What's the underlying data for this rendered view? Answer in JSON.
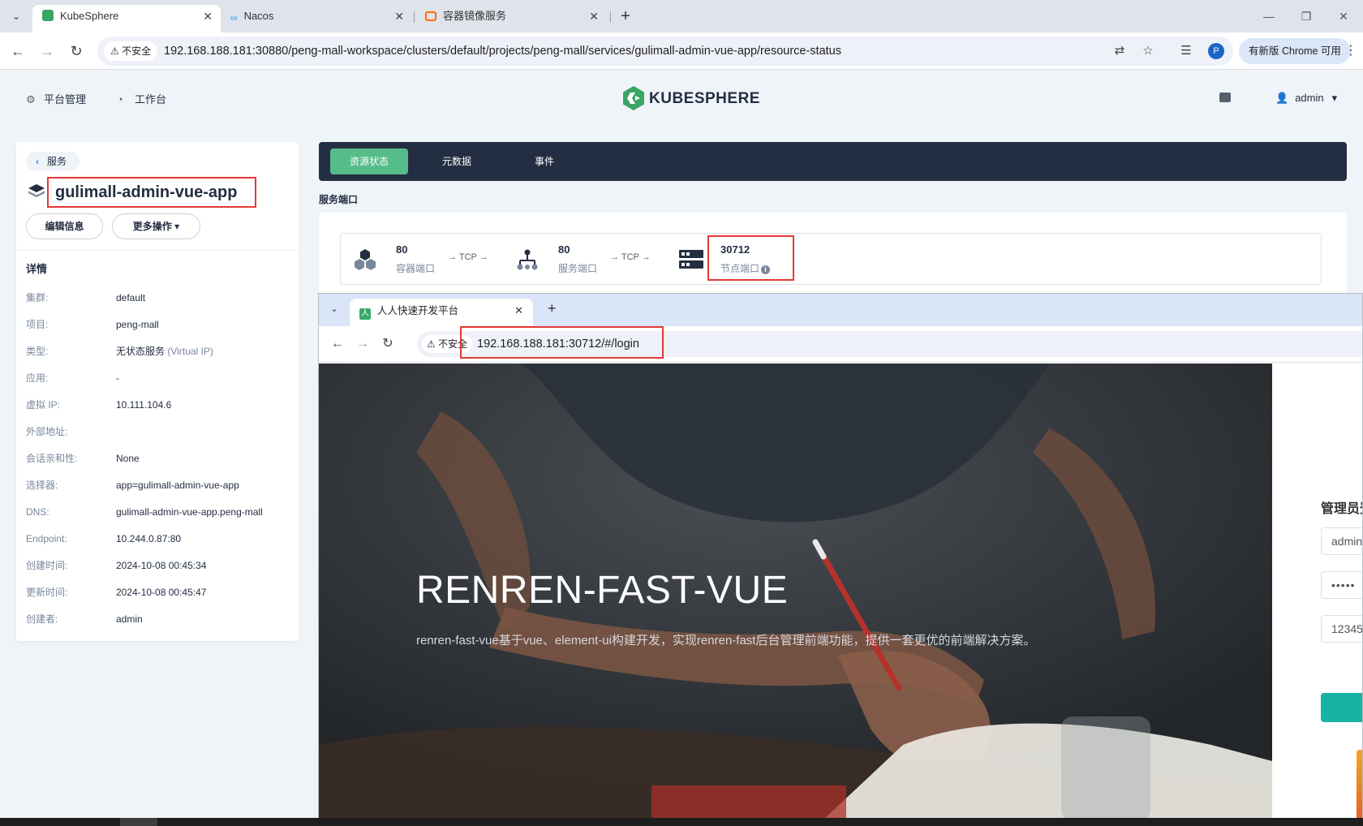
{
  "browser": {
    "tabs": [
      {
        "title": "KubeSphere",
        "active": true
      },
      {
        "title": "Nacos",
        "active": false
      },
      {
        "title": "容器镜像服务",
        "active": false
      }
    ],
    "security_label": "不安全",
    "url": "192.168.188.181:30880/peng-mall-workspace/clusters/default/projects/peng-mall/services/gulimall-admin-vue-app/resource-status",
    "profile_initial": "P",
    "update_label": "有新版 Chrome 可用"
  },
  "header": {
    "platform_label": "平台管理",
    "workbench_label": "工作台",
    "logo_text": "KUBESPHERE",
    "user_name": "admin"
  },
  "service": {
    "back_label": "服务",
    "name": "gulimall-admin-vue-app",
    "edit_label": "编辑信息",
    "more_label": "更多操作",
    "details_title": "详情",
    "details": [
      {
        "key": "集群:",
        "value": "default"
      },
      {
        "key": "项目:",
        "value": "peng-mall"
      },
      {
        "key": "类型:",
        "value": "无状态服务",
        "extra": "(Virtual IP)"
      },
      {
        "key": "应用:",
        "value": "-"
      },
      {
        "key": "虚拟 IP:",
        "value": "10.111.104.6"
      },
      {
        "key": "外部地址:",
        "value": ""
      },
      {
        "key": "会话亲和性:",
        "value": "None"
      },
      {
        "key": "选择器:",
        "value": "app=gulimall-admin-vue-app"
      },
      {
        "key": "DNS:",
        "value": "gulimall-admin-vue-app.peng-mall"
      },
      {
        "key": "Endpoint:",
        "value": "10.244.0.87:80"
      },
      {
        "key": "创建时间:",
        "value": "2024-10-08 00:45:34"
      },
      {
        "key": "更新时间:",
        "value": "2024-10-08 00:45:47"
      },
      {
        "key": "创建者:",
        "value": "admin"
      }
    ]
  },
  "resource_tabs": [
    "资源状态",
    "元数据",
    "事件"
  ],
  "ports": {
    "section_title": "服务端口",
    "container_port": "80",
    "container_port_label": "容器端口",
    "protocol_1": "→ TCP →",
    "service_port": "80",
    "service_port_label": "服务端口",
    "protocol_2": "→ TCP →",
    "node_port": "30712",
    "node_port_label": "节点端口"
  },
  "popup": {
    "tab_title": "人人快速开发平台",
    "fav_glyph": "人",
    "security_label": "不安全",
    "url": "192.168.188.181:30712/#/login",
    "hero_title": "RENREN-FAST-VUE",
    "hero_desc": "renren-fast-vue基于vue、element-ui构建开发，实现renren-fast后台管理前端功能，提供一套更优的前端解决方案。",
    "login_title": "管理员登录",
    "username_value": "admin",
    "password_value": "•••••",
    "captcha_value": "12345"
  },
  "colors": {
    "accent_green": "#55bc8a",
    "dark_nav": "#242e42",
    "highlight_red": "#e53935",
    "login_teal": "#17b3a3"
  }
}
